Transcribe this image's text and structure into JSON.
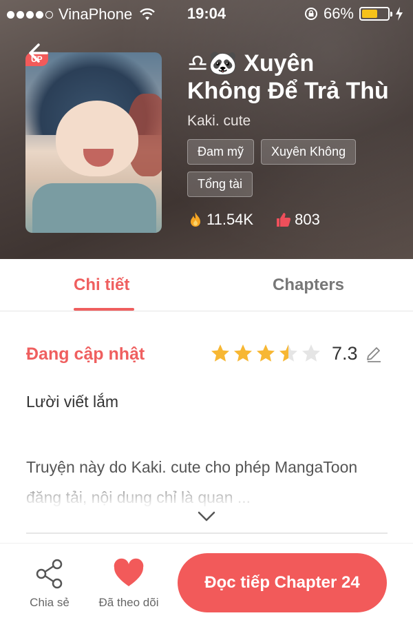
{
  "status_bar": {
    "carrier": "VinaPhone",
    "time": "19:04",
    "battery": "66%",
    "battery_level": 0.66
  },
  "header": {
    "badge": "UP",
    "title": "♎🐼 Xuyên Không Để Trả Thù",
    "author": "Kaki. cute",
    "tags": [
      "Đam mỹ",
      "Xuyên Không",
      "Tổng tài"
    ],
    "views": "11.54K",
    "likes": "803"
  },
  "tabs": {
    "detail": "Chi tiết",
    "chapters": "Chapters",
    "active": "detail"
  },
  "detail": {
    "status": "Đang cập nhật",
    "rating_stars": 3.5,
    "rating_max": 5,
    "score": "7.3",
    "short_description": "Lười viết lắm",
    "long_description": "Truyện này do Kaki. cute cho phép MangaToon đăng tải, nội dung chỉ là quan ..."
  },
  "bottom_bar": {
    "share_label": "Chia sẻ",
    "follow_label": "Đã theo dõi",
    "read_button": "Đọc tiếp Chapter 24"
  },
  "colors": {
    "accent": "#f25a5a",
    "star": "#f7b733",
    "star_empty": "#e5e5e5"
  }
}
